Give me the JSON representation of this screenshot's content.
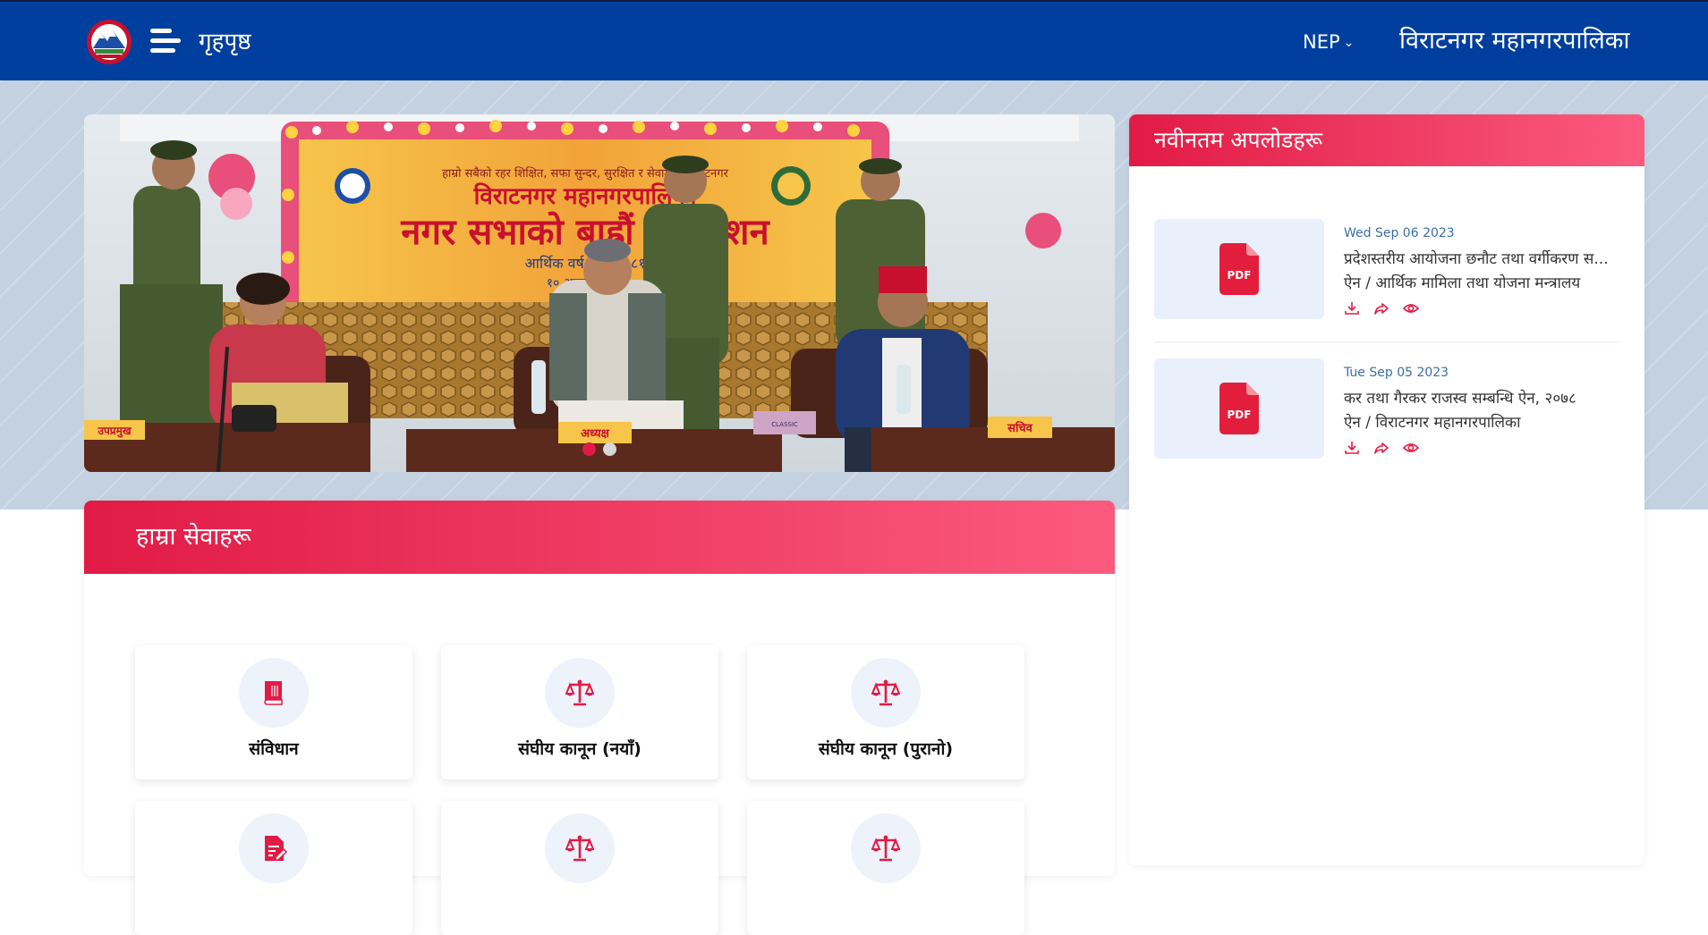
{
  "header": {
    "home_label": "गृहपृष्ठ",
    "language": "NEP",
    "municipality": "विराटनगर महानगरपालिका"
  },
  "carousel": {
    "slides": 2,
    "active_slide": 1,
    "banner": {
      "line1": "हाम्रो सबैको रहर शिक्षित, सफा सुन्दर, सुरक्षित र सेवामुखी विराटनगर",
      "line2": "विराटनगर महानगरपालिका",
      "line3": "नगर सभाको बाह्रौं अधिवेशन",
      "line4": "आर्थिक वर्ष २०८०/०८१",
      "line5": "१० आषाढ २०८०"
    },
    "nameplates": {
      "left": "उपप्रमुख",
      "center": "अध्यक्ष",
      "right": "सचिव"
    },
    "tissue_box": "CLASSIC"
  },
  "uploads": {
    "heading": "नवीनतम अपलोडहरू",
    "items": [
      {
        "date": "Wed Sep 06 2023",
        "title": "प्रदेशस्तरीय आयोजना छनौट तथा वर्गीकरण स...",
        "category": "ऐन / आर्थिक मामिला तथा योजना मन्त्रालय",
        "file_type": "PDF"
      },
      {
        "date": "Tue Sep 05 2023",
        "title": "कर तथा गैरकर राजस्व सम्बन्धि ऐन, २०७८",
        "category": "ऐन / विराटनगर महानगरपालिका",
        "file_type": "PDF"
      }
    ]
  },
  "services": {
    "heading": "हाम्रा सेवाहरू",
    "items": [
      {
        "label": "संविधान",
        "icon": "book-icon"
      },
      {
        "label": "संघीय कानून (नयाँ)",
        "icon": "scales-icon"
      },
      {
        "label": "संघीय कानून (पुरानो)",
        "icon": "scales-icon"
      },
      {
        "label": "",
        "icon": "document-edit-icon"
      },
      {
        "label": "",
        "icon": "scales-icon"
      },
      {
        "label": "",
        "icon": "scales-icon"
      }
    ]
  },
  "colors": {
    "header_bg": "#003f9e",
    "accent_red": "#e11b45",
    "accent_pink": "#fb5a7e",
    "date_blue": "#3b6ea5",
    "icon_circle": "#edf2fb"
  }
}
